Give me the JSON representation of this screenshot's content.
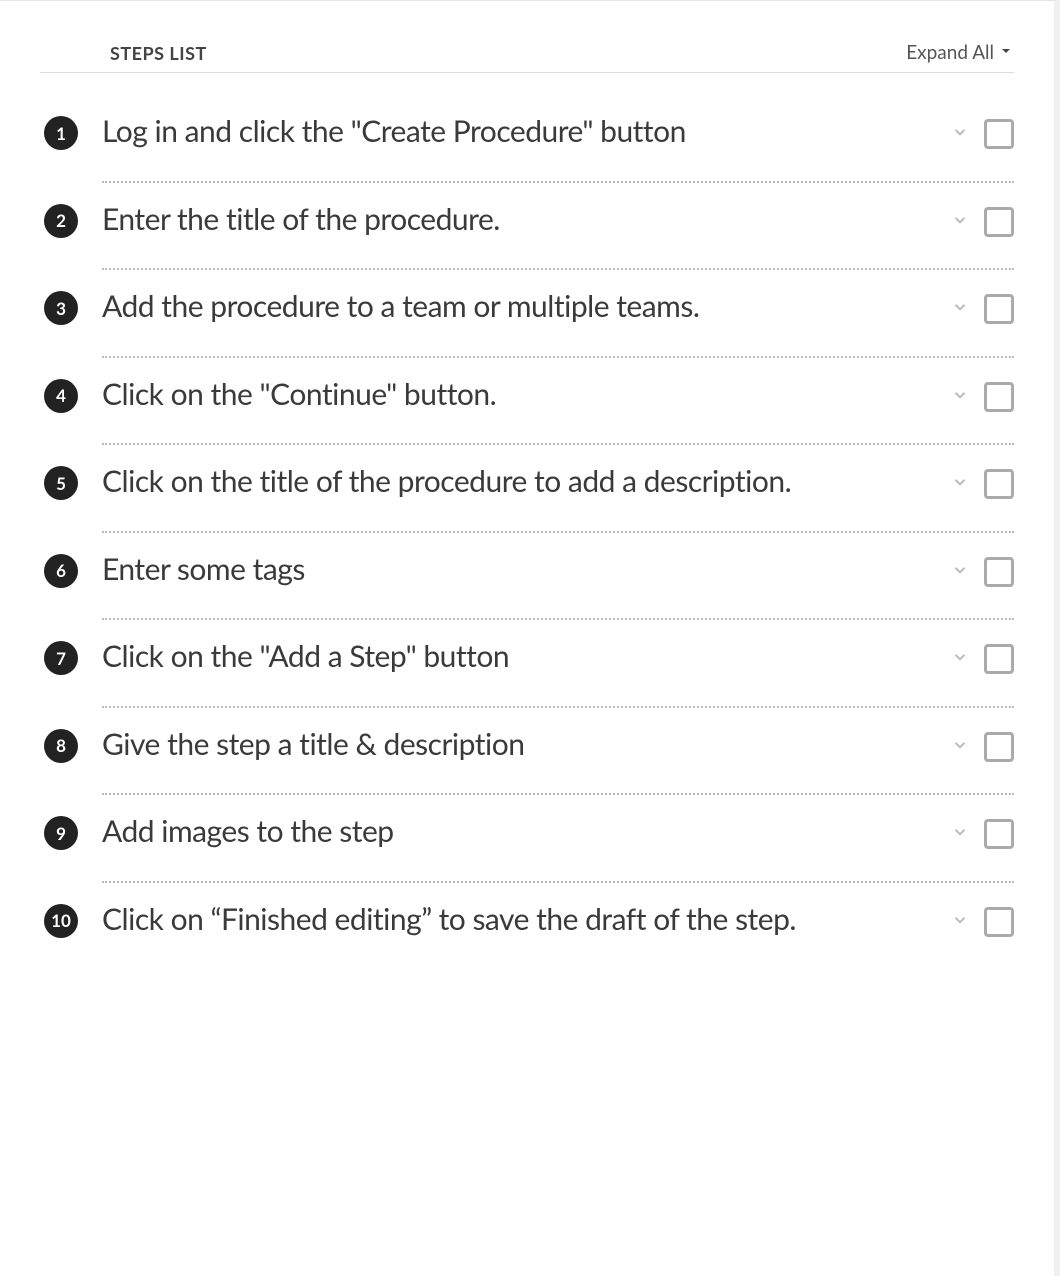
{
  "header": {
    "steps_list_label": "STEPS LIST",
    "expand_all_label": "Expand All"
  },
  "steps": [
    {
      "number": "1",
      "title": "Log in and click the \"Create Procedure\" button"
    },
    {
      "number": "2",
      "title": "Enter the title of the procedure."
    },
    {
      "number": "3",
      "title": "Add the procedure to a team or multiple teams."
    },
    {
      "number": "4",
      "title": "Click on the \"Continue\" button."
    },
    {
      "number": "5",
      "title": "Click on the title of the procedure to add a description."
    },
    {
      "number": "6",
      "title": "Enter some tags"
    },
    {
      "number": "7",
      "title": "Click on the \"Add a Step\" button"
    },
    {
      "number": "8",
      "title": "Give the step a title & description"
    },
    {
      "number": "9",
      "title": "Add images to the step"
    },
    {
      "number": "10",
      "title": "Click on “Finished editing” to save the draft of the step."
    }
  ]
}
